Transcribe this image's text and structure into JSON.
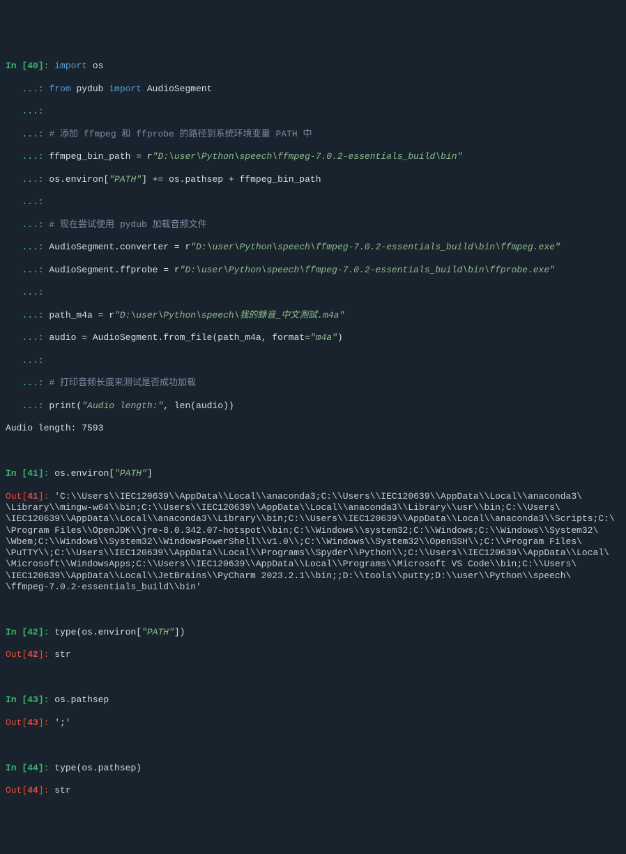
{
  "cells": {
    "c40": {
      "num": "40",
      "in_label": "In [",
      "close": "]: ",
      "cont": "   ...: ",
      "l1_kw1": "import",
      "l1_mod": " os",
      "l2_kw1": "from",
      "l2_mod": " pydub ",
      "l2_kw2": "import",
      "l2_cls": " AudioSegment",
      "c1": "# 添加 ffmpeg 和 ffprobe 的路径到系统环境变量 PATH 中",
      "l4a": "ffmpeg_bin_path = r",
      "l4s": "\"D:\\user\\Python\\speech\\ffmpeg-7.0.2-essentials_build\\bin\"",
      "l5a": "os.environ[",
      "l5s": "\"PATH\"",
      "l5b": "] += os.pathsep + ffmpeg_bin_path",
      "c2": "# 现在尝试使用 pydub 加载音频文件",
      "l7a": "AudioSegment.converter = r",
      "l7s": "\"D:\\user\\Python\\speech\\ffmpeg-7.0.2-essentials_build\\bin\\ffmpeg.exe\"",
      "l8a": "AudioSegment.ffprobe = r",
      "l8s": "\"D:\\user\\Python\\speech\\ffmpeg-7.0.2-essentials_build\\bin\\ffprobe.exe\"",
      "l9a": "path_m4a = r",
      "l9s": "\"D:\\user\\Python\\speech\\我的錄音_中文測試.m4a\"",
      "l10a": "audio = AudioSegment.from_file(path_m4a, format=",
      "l10s": "\"m4a\"",
      "l10b": ")",
      "c3": "# 打印音频长度来测试是否成功加载",
      "l11a": "print(",
      "l11s": "\"Audio length:\"",
      "l11b": ", len(audio))",
      "output": "Audio length: 7593"
    },
    "c41": {
      "num": "41",
      "expr_a": "os.environ[",
      "expr_s": "\"PATH\"",
      "expr_b": "]",
      "out": "'C:\\\\Users\\\\IEC120639\\\\AppData\\\\Local\\\\anaconda3;C:\\\\Users\\\\IEC120639\\\\AppData\\\\Local\\\\anaconda3\\\n\\Library\\\\mingw-w64\\\\bin;C:\\\\Users\\\\IEC120639\\\\AppData\\\\Local\\\\anaconda3\\\\Library\\\\usr\\\\bin;C:\\\\Users\\\n\\IEC120639\\\\AppData\\\\Local\\\\anaconda3\\\\Library\\\\bin;C:\\\\Users\\\\IEC120639\\\\AppData\\\\Local\\\\anaconda3\\\\Scripts;C:\\\n\\Program Files\\\\OpenJDK\\\\jre-8.0.342.07-hotspot\\\\bin;C:\\\\Windows\\\\system32;C:\\\\Windows;C:\\\\Windows\\\\System32\\\n\\Wbem;C:\\\\Windows\\\\System32\\\\WindowsPowerShell\\\\v1.0\\\\;C:\\\\Windows\\\\System32\\\\OpenSSH\\\\;C:\\\\Program Files\\\n\\PuTTY\\\\;C:\\\\Users\\\\IEC120639\\\\AppData\\\\Local\\\\Programs\\\\Spyder\\\\Python\\\\;C:\\\\Users\\\\IEC120639\\\\AppData\\\\Local\\\n\\Microsoft\\\\WindowsApps;C:\\\\Users\\\\IEC120639\\\\AppData\\\\Local\\\\Programs\\\\Microsoft VS Code\\\\bin;C:\\\\Users\\\n\\IEC120639\\\\AppData\\\\Local\\\\JetBrains\\\\PyCharm 2023.2.1\\\\bin;;D:\\\\tools\\\\putty;D:\\\\user\\\\Python\\\\speech\\\n\\ffmpeg-7.0.2-essentials_build\\\\bin'"
    },
    "c42": {
      "num": "42",
      "expr_a": "type(os.environ[",
      "expr_s": "\"PATH\"",
      "expr_b": "])",
      "out": "str"
    },
    "c43": {
      "num": "43",
      "expr": "os.pathsep",
      "out": "';'"
    },
    "c44": {
      "num": "44",
      "expr": "type(os.pathsep)",
      "out": "str"
    }
  },
  "labels": {
    "in_open": "In [",
    "out_open": "Out[",
    "close": "]: "
  }
}
